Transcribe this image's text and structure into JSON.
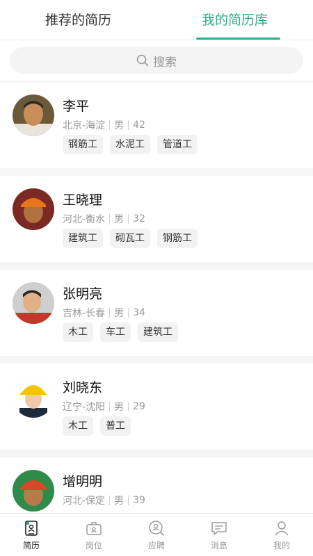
{
  "tabs": [
    {
      "label": "推荐的简历"
    },
    {
      "label": "我的简历库"
    }
  ],
  "search": {
    "placeholder": "搜索"
  },
  "resumes": [
    {
      "name": "李平",
      "location": "北京-海淀",
      "gender": "男",
      "age": "42",
      "tags": [
        "钢筋工",
        "水泥工",
        "管道工"
      ]
    },
    {
      "name": "王晓理",
      "location": "河北-衡水",
      "gender": "男",
      "age": "32",
      "tags": [
        "建筑工",
        "砌瓦工",
        "钢筋工"
      ]
    },
    {
      "name": "张明亮",
      "location": "吉林-长春",
      "gender": "男",
      "age": "34",
      "tags": [
        "木工",
        "车工",
        "建筑工"
      ]
    },
    {
      "name": "刘晓东",
      "location": "辽宁-沈阳",
      "gender": "男",
      "age": "29",
      "tags": [
        "木工",
        "普工"
      ]
    },
    {
      "name": "增明明",
      "location": "河北-保定",
      "gender": "男",
      "age": "39",
      "tags": []
    }
  ],
  "nav": [
    {
      "label": "简历",
      "icon": "resume-icon"
    },
    {
      "label": "岗位",
      "icon": "briefcase-icon"
    },
    {
      "label": "应聘",
      "icon": "search-person-icon"
    },
    {
      "label": "消息",
      "icon": "message-icon"
    },
    {
      "label": "我的",
      "icon": "profile-icon"
    }
  ],
  "colors": {
    "accent": "#2db08a"
  }
}
